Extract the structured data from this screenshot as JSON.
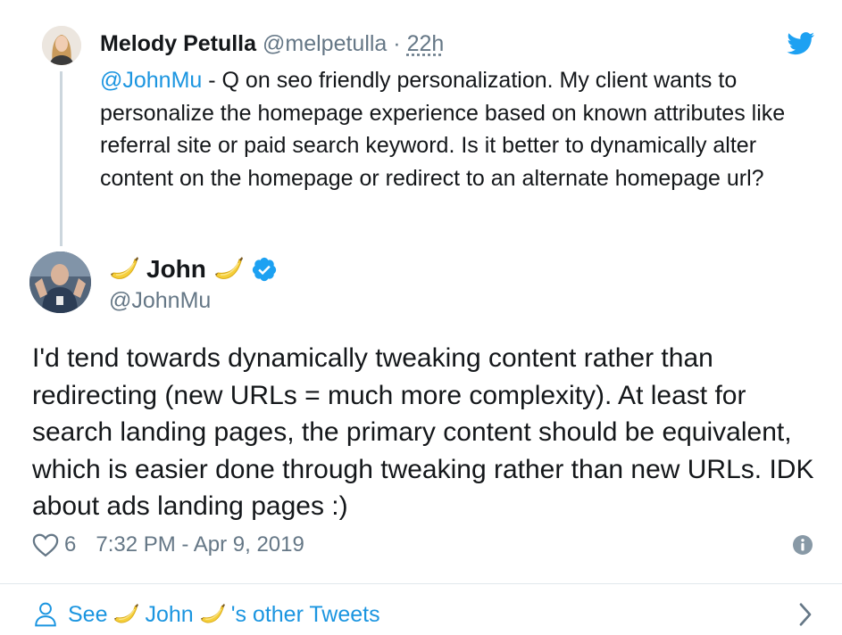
{
  "parent_tweet": {
    "author_name": "Melody Petulla",
    "handle": "@melpetulla",
    "separator": "·",
    "time": "22h",
    "mention": "@JohnMu",
    "text": " - Q on seo friendly personalization. My client wants to personalize the homepage experience based on known attributes like referral site or paid search keyword. Is it better to dynamically alter content on the homepage or redirect to an alternate homepage url?"
  },
  "main_tweet": {
    "author_name": "John",
    "handle": "@JohnMu",
    "verified": true,
    "text": "I'd tend towards dynamically tweaking content rather than redirecting (new URLs = much more complexity). At least for search landing pages, the primary content should be equivalent, which is easier done through tweaking rather than new URLs. IDK about ads landing pages :)",
    "like_count": "6",
    "timestamp": "7:32 PM - Apr 9, 2019"
  },
  "footer": {
    "see_label": "See",
    "author_name": "John",
    "suffix": "'s other Tweets"
  },
  "icons": {
    "brand": "twitter-bird-icon",
    "verified": "verified-badge-icon",
    "like": "heart-icon",
    "info": "info-icon",
    "profile": "person-icon",
    "more": "chevron-right-icon",
    "emoji": "banana-emoji-icon"
  },
  "colors": {
    "twitter_blue": "#1da1f2",
    "link_blue": "#1b95e0",
    "text": "#14171a",
    "muted": "#657786",
    "divider": "#e1e8ed",
    "banana": "#f5cf3a"
  }
}
